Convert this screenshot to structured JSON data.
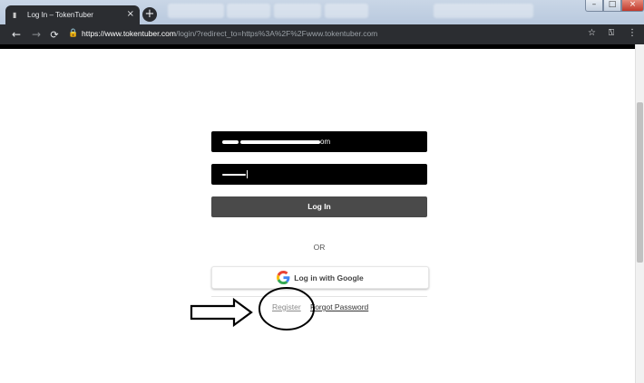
{
  "browser": {
    "tab_title": "Log In – TokenTuber",
    "tab_close_glyph": "×",
    "new_tab_glyph": "+",
    "url_host": "https://www.tokentuber.com",
    "url_rest": "/login/?redirect_to=https%3A%2F%2Fwww.tokentuber.com",
    "icons": {
      "back": "←",
      "forward": "→",
      "reload": "⟳",
      "lock": "🔒",
      "star": "☆",
      "extension": "⍂",
      "menu": "⋮",
      "minimize": "–",
      "maximize": "□",
      "close": "×"
    }
  },
  "form": {
    "email_suffix": "om",
    "login_label": "Log In",
    "or_label": "OR",
    "google_label": "Log in with Google",
    "register_label": "Register",
    "forgot_label": "Forgot Password"
  },
  "colors": {
    "field_bg": "#000000",
    "login_button": "#4a4a4a",
    "toolbar": "#2b2d31"
  }
}
